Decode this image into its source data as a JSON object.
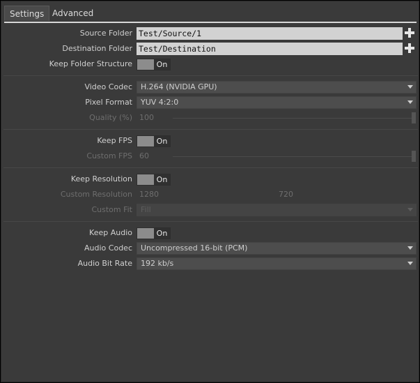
{
  "tabs": [
    {
      "label": "Settings"
    },
    {
      "label": "Advanced"
    }
  ],
  "source_folder": {
    "label": "Source Folder",
    "value": "Test/Source/1"
  },
  "destination_folder": {
    "label": "Destination Folder",
    "value": "Test/Destination"
  },
  "keep_folder_structure": {
    "label": "Keep Folder Structure",
    "state": "On"
  },
  "video_codec": {
    "label": "Video Codec",
    "value": "H.264 (NVIDIA GPU)"
  },
  "pixel_format": {
    "label": "Pixel Format",
    "value": "YUV 4:2:0"
  },
  "quality": {
    "label": "Quality (%)",
    "value": "100"
  },
  "keep_fps": {
    "label": "Keep FPS",
    "state": "On"
  },
  "custom_fps": {
    "label": "Custom FPS",
    "value": "60"
  },
  "keep_resolution": {
    "label": "Keep Resolution",
    "state": "On"
  },
  "custom_resolution": {
    "label": "Custom Resolution",
    "width": "1280",
    "height": "720"
  },
  "custom_fit": {
    "label": "Custom Fit",
    "value": "Fill"
  },
  "keep_audio": {
    "label": "Keep Audio",
    "state": "On"
  },
  "audio_codec": {
    "label": "Audio Codec",
    "value": "Uncompressed 16-bit (PCM)"
  },
  "audio_bit_rate": {
    "label": "Audio Bit Rate",
    "value": "192 kb/s"
  },
  "icons": {
    "add_source": "plus-icon",
    "add_destination": "plus-icon",
    "dropdown": "chevron-down-icon"
  }
}
